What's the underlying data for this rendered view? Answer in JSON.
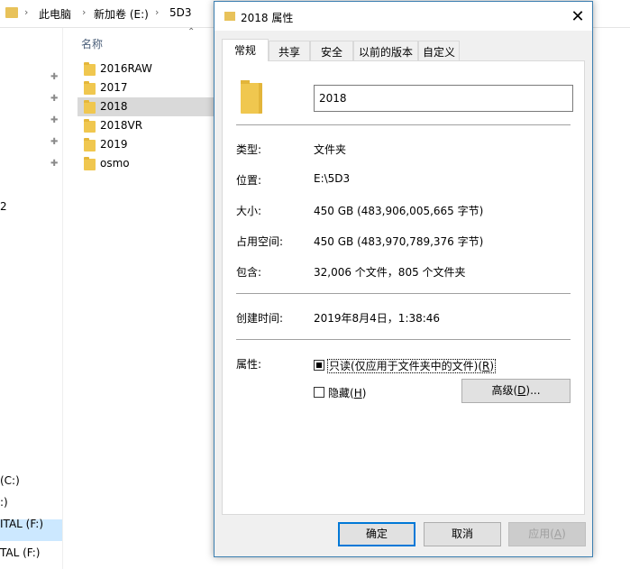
{
  "explorer": {
    "breadcrumb": [
      "此电脑",
      "新加卷 (E:)",
      "5D3"
    ],
    "breadcrumb_separator": "›",
    "column_header": "名称",
    "folders": [
      {
        "name": "2016RAW",
        "selected": false
      },
      {
        "name": "2017",
        "selected": false
      },
      {
        "name": "2018",
        "selected": true
      },
      {
        "name": "2018VR",
        "selected": false
      },
      {
        "name": "2019",
        "selected": false
      },
      {
        "name": "osmo",
        "selected": false
      }
    ],
    "nav_items": [
      "2",
      "(C:)",
      ":)",
      "ITAL (F:)",
      "TAL (F:)"
    ],
    "pin_icon": "pin-icon"
  },
  "dialog": {
    "title": "2018 属性",
    "tabs": [
      "常规",
      "共享",
      "安全",
      "以前的版本",
      "自定义"
    ],
    "active_tab": "常规",
    "name_value": "2018",
    "props": {
      "type_label": "类型:",
      "type_value": "文件夹",
      "location_label": "位置:",
      "location_value": "E:\\5D3",
      "size_label": "大小:",
      "size_value": "450 GB (483,906,005,665 字节)",
      "size_on_disk_label": "占用空间:",
      "size_on_disk_value": "450 GB (483,970,789,376 字节)",
      "contains_label": "包含:",
      "contains_value": "32,006 个文件，805 个文件夹",
      "created_label": "创建时间:",
      "created_value": "2019年8月4日，1:38:46",
      "attributes_label": "属性:"
    },
    "readonly": {
      "prefix": "只读(仅应用于文件夹中的文件)(",
      "key": "R",
      "suffix": ")",
      "state": "indeterminate"
    },
    "hidden": {
      "prefix": "隐藏(",
      "key": "H",
      "suffix": ")",
      "checked": false
    },
    "advanced": {
      "prefix": "高级(",
      "key": "D",
      "suffix": ")..."
    },
    "buttons": {
      "ok": "确定",
      "cancel": "取消",
      "apply_prefix": "应用(",
      "apply_key": "A",
      "apply_suffix": ")"
    },
    "accent_color": "#0078d7",
    "folder_color": "#f0c74f"
  }
}
